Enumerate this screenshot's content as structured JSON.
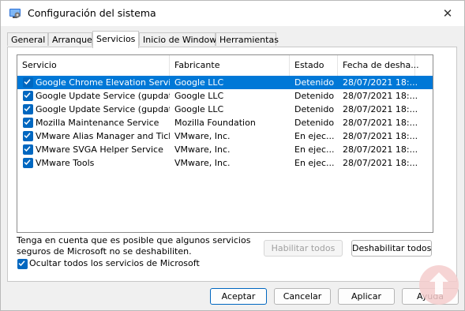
{
  "window": {
    "title": "Configuración del sistema"
  },
  "tabs": [
    {
      "label": "General",
      "active": false
    },
    {
      "label": "Arranque",
      "active": false
    },
    {
      "label": "Servicios",
      "active": true
    },
    {
      "label": "Inicio de Windows",
      "active": false
    },
    {
      "label": "Herramientas",
      "active": false
    }
  ],
  "columns": [
    "Servicio",
    "Fabricante",
    "Estado",
    "Fecha de desha..."
  ],
  "services": [
    {
      "name": "Google Chrome Elevation Servic...",
      "vendor": "Google LLC",
      "status": "Detenido",
      "date": "28/07/2021 18:...",
      "checked": true,
      "selected": true
    },
    {
      "name": "Google Update Service (gupdate)",
      "vendor": "Google LLC",
      "status": "Detenido",
      "date": "28/07/2021 18:...",
      "checked": true,
      "selected": false
    },
    {
      "name": "Google Update Service (gupdatem)",
      "vendor": "Google LLC",
      "status": "Detenido",
      "date": "28/07/2021 18:...",
      "checked": true,
      "selected": false
    },
    {
      "name": "Mozilla Maintenance Service",
      "vendor": "Mozilla Foundation",
      "status": "Detenido",
      "date": "28/07/2021 18:...",
      "checked": true,
      "selected": false
    },
    {
      "name": "VMware Alias Manager and Ticke...",
      "vendor": "VMware, Inc.",
      "status": "En ejec...",
      "date": "28/07/2021 18:...",
      "checked": true,
      "selected": false
    },
    {
      "name": "VMware SVGA Helper Service",
      "vendor": "VMware, Inc.",
      "status": "En ejec...",
      "date": "28/07/2021 18:...",
      "checked": true,
      "selected": false
    },
    {
      "name": "VMware Tools",
      "vendor": "VMware, Inc.",
      "status": "En ejec...",
      "date": "28/07/2021 18:...",
      "checked": true,
      "selected": false
    }
  ],
  "note": "Tenga en cuenta que es posible que algunos servicios\nseguros de Microsoft no se deshabiliten.",
  "enable_all": "Habilitar todos",
  "disable_all": "Deshabilitar todos",
  "hide_ms": {
    "label": "Ocultar todos los servicios de Microsoft",
    "checked": true
  },
  "buttons": {
    "ok": "Aceptar",
    "cancel": "Cancelar",
    "apply": "Aplicar",
    "help": "Ayuda"
  },
  "colors": {
    "accent": "#0067c0",
    "selection": "#0078d7"
  }
}
